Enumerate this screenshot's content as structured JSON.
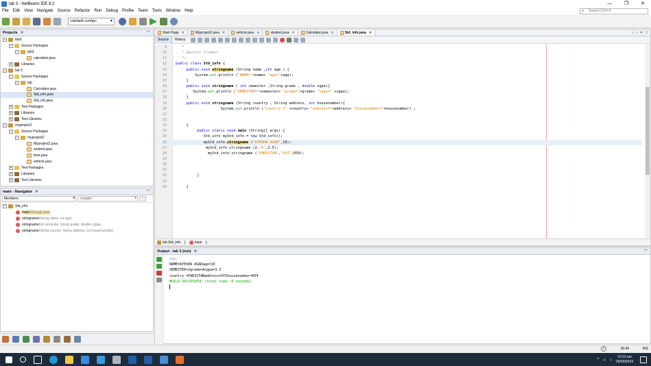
{
  "window": {
    "title": "lab 3 - NetBeans IDE 8.2",
    "controls": [
      "—",
      "❐",
      "✕"
    ]
  },
  "menubar": {
    "items": [
      "File",
      "Edit",
      "View",
      "Navigate",
      "Source",
      "Refactor",
      "Run",
      "Debug",
      "Profile",
      "Team",
      "Tools",
      "Window",
      "Help"
    ]
  },
  "search": {
    "placeholder": "Search (Ctrl+I)"
  },
  "toolbar": {
    "config": "<default config>"
  },
  "projects": {
    "tab": "Projects",
    "items": [
      {
        "depth": 0,
        "toggle": "−",
        "icon": "proj",
        "label": "lab3"
      },
      {
        "depth": 1,
        "toggle": "−",
        "icon": "pkgs",
        "label": "Source Packages"
      },
      {
        "depth": 2,
        "toggle": "−",
        "icon": "pkg",
        "label": "lab3"
      },
      {
        "depth": 3,
        "toggle": "",
        "icon": "java",
        "label": "calculator.java"
      },
      {
        "depth": 1,
        "toggle": "+",
        "icon": "lib",
        "label": "Libraries"
      },
      {
        "depth": 0,
        "toggle": "−",
        "icon": "proj",
        "label": "lab 3"
      },
      {
        "depth": 1,
        "toggle": "−",
        "icon": "pkgs",
        "label": "Source Packages"
      },
      {
        "depth": 2,
        "toggle": "−",
        "icon": "pkg",
        "label": "lab"
      },
      {
        "depth": 3,
        "toggle": "",
        "icon": "java",
        "label": "Calculator.java"
      },
      {
        "depth": 3,
        "toggle": "",
        "icon": "java",
        "label": "Std_info.java",
        "selected": true
      },
      {
        "depth": 3,
        "toggle": "",
        "icon": "java",
        "label": "Std_nfo.java"
      },
      {
        "depth": 1,
        "toggle": "+",
        "icon": "pkgs",
        "label": "Test Packages"
      },
      {
        "depth": 1,
        "toggle": "+",
        "icon": "lib",
        "label": "Libraries"
      },
      {
        "depth": 1,
        "toggle": "+",
        "icon": "lib",
        "label": "Test Libraries"
      },
      {
        "depth": 0,
        "toggle": "−",
        "icon": "proj",
        "label": "myproject2"
      },
      {
        "depth": 1,
        "toggle": "−",
        "icon": "pkgs",
        "label": "Source Packages"
      },
      {
        "depth": 2,
        "toggle": "−",
        "icon": "pkg",
        "label": "myproject2"
      },
      {
        "depth": 3,
        "toggle": "",
        "icon": "java",
        "label": "Myproject2.java"
      },
      {
        "depth": 3,
        "toggle": "",
        "icon": "java",
        "label": "student.java"
      },
      {
        "depth": 3,
        "toggle": "",
        "icon": "java",
        "label": "time.java"
      },
      {
        "depth": 3,
        "toggle": "",
        "icon": "java",
        "label": "vehicle.java"
      },
      {
        "depth": 1,
        "toggle": "+",
        "icon": "pkgs",
        "label": "Test Packages"
      },
      {
        "depth": 1,
        "toggle": "+",
        "icon": "lib",
        "label": "Libraries"
      },
      {
        "depth": 1,
        "toggle": "+",
        "icon": "lib",
        "label": "Test Libraries"
      }
    ]
  },
  "navigator": {
    "tab": "main - Navigator",
    "members_label": "Members",
    "filter_value": "<empty>",
    "root": "Std_info",
    "items": [
      {
        "name": "main",
        "params": "(String[] args)",
        "selected": true
      },
      {
        "name": "stringname",
        "params": "(String name, int age)"
      },
      {
        "name": "stringname",
        "params": "(int semester, String grade, double cgpa)"
      },
      {
        "name": "stringname",
        "params": "(String country, String address, int housenumber)"
      }
    ]
  },
  "editor": {
    "tabs": [
      {
        "label": "Start Page",
        "active": false
      },
      {
        "label": "Myproject2.java",
        "active": false
      },
      {
        "label": "vehicle.java",
        "active": false
      },
      {
        "label": "student.java",
        "active": false
      },
      {
        "label": "Calculator.java",
        "active": false
      },
      {
        "label": "Std_info.java",
        "active": true
      }
    ],
    "source_label": "Source",
    "history_label": "History",
    "current_line": 26,
    "lines": [
      {
        "n": 9,
        "html": "<span class='cm'>   *</span>"
      },
      {
        "n": 10,
        "html": "<span class='cm'>   * @author Student</span>"
      },
      {
        "n": 11,
        "html": "<span class='cm'>   */</span>"
      },
      {
        "n": 12,
        "html": "<span class='kw'>public class</span> <span class='bold'>Std_info</span> {"
      },
      {
        "n": 13,
        "html": "     <span class='kw'>public void</span> <span class='mdhl'>stringname</span> (String name ,<span class='kw'>int</span> age ) {"
      },
      {
        "n": 14,
        "html": "         System.<span class='fld'>out</span>.println (<span class='str'>\"NAME=\"</span>+name+ <span class='str'>\"age=\"</span>+age);"
      },
      {
        "n": 15,
        "html": "     }"
      },
      {
        "n": 16,
        "html": "     <span class='kw'>public void</span> <span class='bold'>stringname</span> ( <span class='kw'>int</span> semester ,String grade , <span class='kw'>double</span> cgpa){"
      },
      {
        "n": 17,
        "html": "        System.<span class='fld'>out</span>.println (<span class='str'>\"SEMESTER=\"</span>+semester+ <span class='str'>\"grade=\"</span>+grade+ <span class='str'>\"cgpa=\"</span> +cgpa);"
      },
      {
        "n": 18,
        "html": "     }"
      },
      {
        "n": 19,
        "html": "     <span class='kw'>public void</span> <span class='bold'>stringname</span> (String country , String address, <span class='kw'>int</span> housenumber){"
      },
      {
        "n": 20,
        "html": "                     System.<span class='fld'>out</span>.println (<span class='str'>\"country =\"</span> +country+ <span class='str'>\"address=\"</span>+address+ <span class='str'>\"housenumber=\"</span>+housenumber) ;"
      },
      {
        "n": 21,
        "html": ""
      },
      {
        "n": 22,
        "html": ""
      },
      {
        "n": 23,
        "html": "     }"
      },
      {
        "n": 24,
        "html": "          <span class='kw'>public static void</span> <span class='bold'>main</span> (String[] args) {"
      },
      {
        "n": 25,
        "html": "             Std_info myStd_info = <span class='kw'>new</span> Std_info();"
      },
      {
        "n": 26,
        "html": "             myStd_info.<span class='mdhl'>stringname</span> (<span class='str'>\"AYESHA ASAD\"</span>,19);"
      },
      {
        "n": 27,
        "html": "              myStd_info.stringname (2,<span class='str'>\"A\"</span>,3.5);"
      },
      {
        "n": 28,
        "html": "               myStd_info.stringname (<span class='str'>\"PAKISTAN\"</span>,<span class='str'>\"XYZ\"</span>,654);"
      },
      {
        "n": 29,
        "html": ""
      },
      {
        "n": 30,
        "html": ""
      },
      {
        "n": 31,
        "html": ""
      },
      {
        "n": 32,
        "html": "          }"
      },
      {
        "n": 33,
        "html": ""
      },
      {
        "n": 34,
        "html": "     }"
      }
    ]
  },
  "breadcrumb": {
    "class_name": "lab.Std_info",
    "method_name": "main"
  },
  "output": {
    "tab": "Output - lab 3 (run)",
    "lines": [
      {
        "text": "run:",
        "style": "muted"
      },
      {
        "text": "NAME=AYESHA ASADage=19",
        "style": ""
      },
      {
        "text": "SEMESTER=2grade=Acgpa=3.5",
        "style": ""
      },
      {
        "text": "country =PAKISTANaddress=XYZhousenumber=654",
        "style": ""
      },
      {
        "text": "BUILD SUCCESSFUL (total time: 0 seconds)",
        "style": "ok"
      }
    ]
  },
  "statusbar": {
    "position": "26:49",
    "mode": "INS"
  },
  "taskbar": {
    "apps": [
      "start-icon",
      "search-icon",
      "task-view-icon",
      "edge-icon",
      "file-explorer-icon",
      "store-icon",
      "mail-icon",
      "game-icon",
      "virtualbox-icon",
      "word-icon",
      "paint-icon",
      "netbeans-icon"
    ],
    "time": "10:13 am",
    "date": "25/09/2024"
  }
}
